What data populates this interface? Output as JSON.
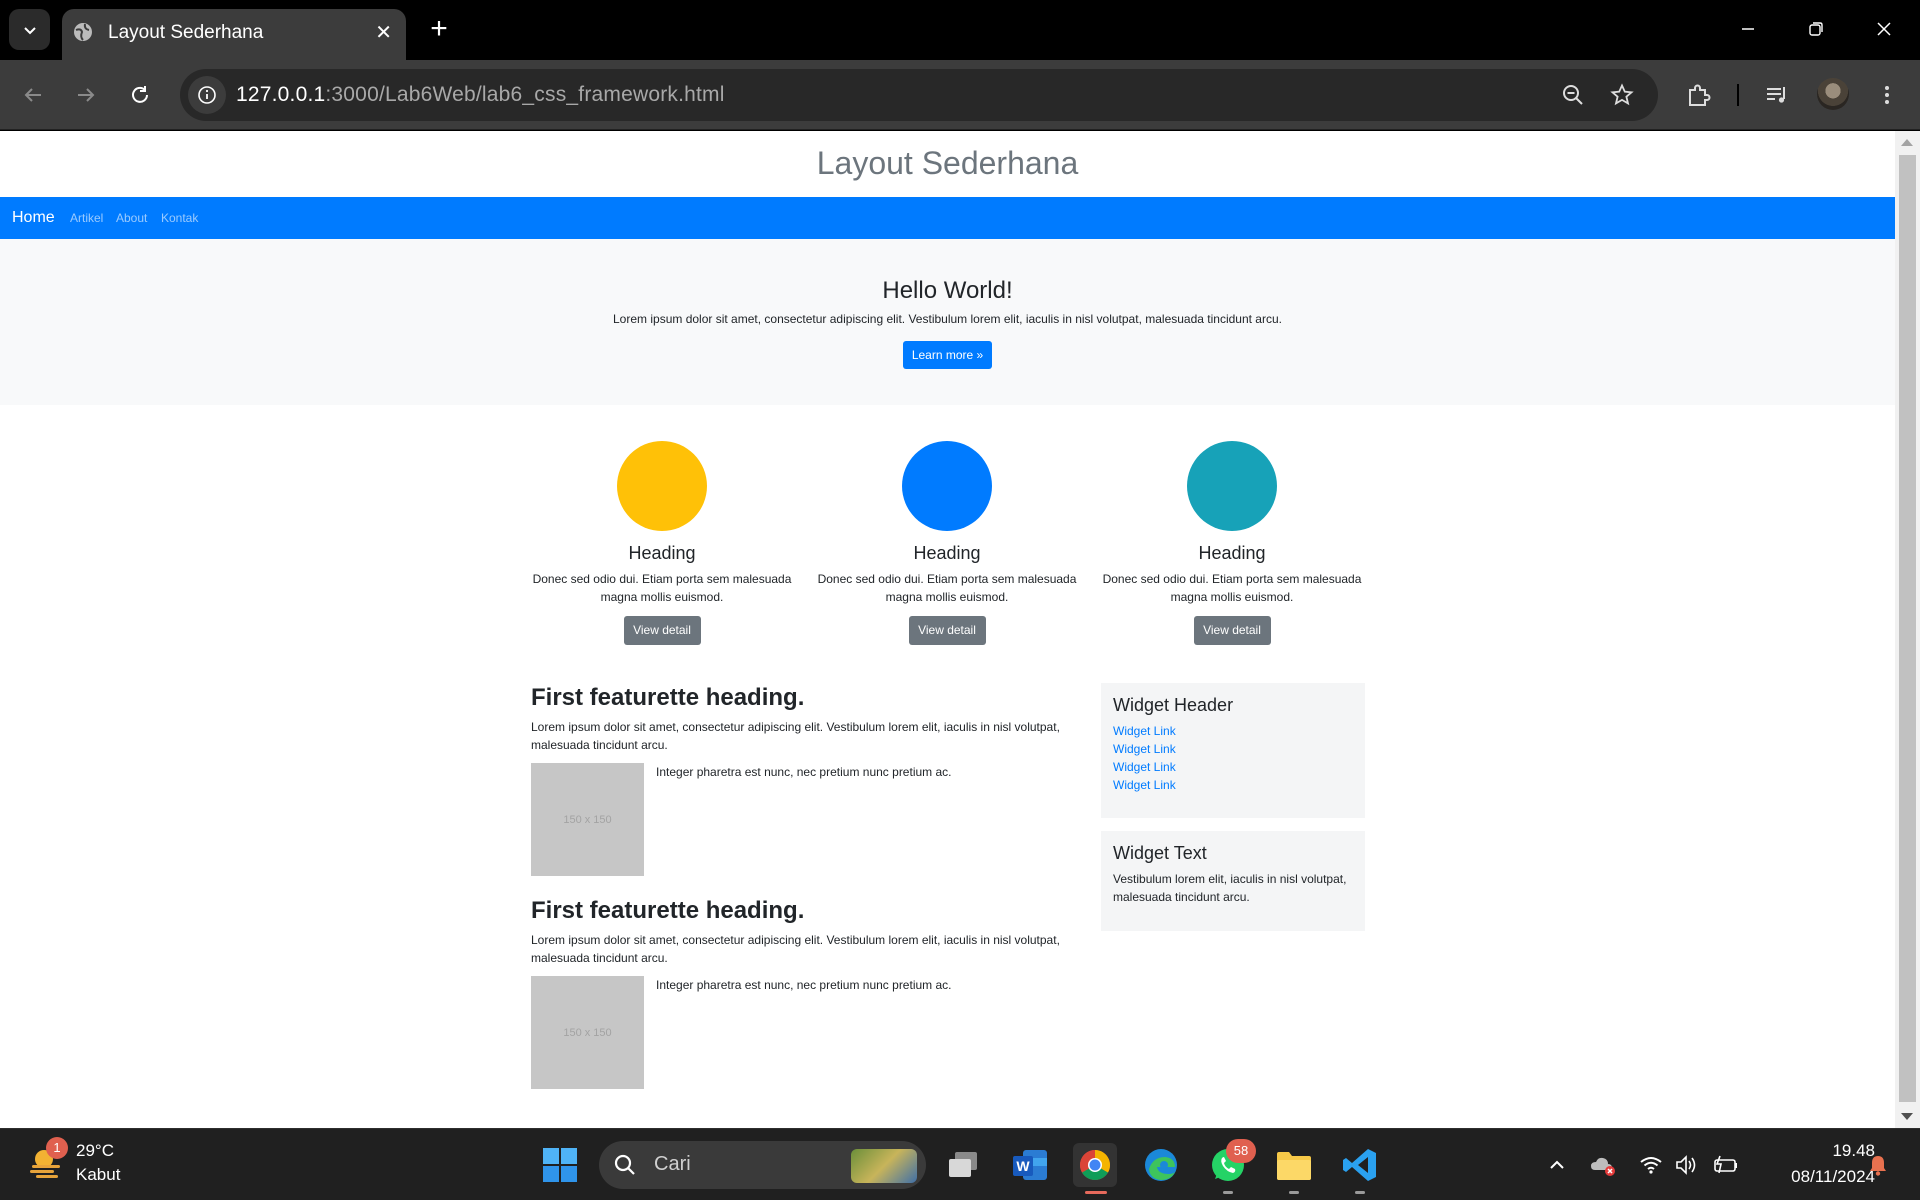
{
  "browser": {
    "tab_title": "Layout Sederhana",
    "url_host": "127.0.0.1",
    "url_rest": ":3000/Lab6Web/lab6_css_framework.html"
  },
  "page": {
    "title": "Layout Sederhana",
    "nav": {
      "home": "Home",
      "artikel": "Artikel",
      "about": "About",
      "kontak": "Kontak"
    },
    "jumbotron": {
      "heading": "Hello World!",
      "text": "Lorem ipsum dolor sit amet, consectetur adipiscing elit. Vestibulum lorem elit, iaculis in nisl volutpat, malesuada tincidunt arcu.",
      "button": "Learn more »"
    },
    "columns": [
      {
        "color": "#ffc107",
        "heading": "Heading",
        "text": "Donec sed odio dui. Etiam porta sem malesuada magna mollis euismod.",
        "button": "View detail"
      },
      {
        "color": "#007bff",
        "heading": "Heading",
        "text": "Donec sed odio dui. Etiam porta sem malesuada magna mollis euismod.",
        "button": "View detail"
      },
      {
        "color": "#17a2b8",
        "heading": "Heading",
        "text": "Donec sed odio dui. Etiam porta sem malesuada magna mollis euismod.",
        "button": "View detail"
      }
    ],
    "featurettes": [
      {
        "heading": "First featurette heading.",
        "lead": "Lorem ipsum dolor sit amet, consectetur adipiscing elit. Vestibulum lorem elit, iaculis in nisl volutpat, malesuada tincidunt arcu.",
        "thumb": "150 x 150",
        "media_text": "Integer pharetra est nunc, nec pretium nunc pretium ac."
      },
      {
        "heading": "First featurette heading.",
        "lead": "Lorem ipsum dolor sit amet, consectetur adipiscing elit. Vestibulum lorem elit, iaculis in nisl volutpat, malesuada tincidunt arcu.",
        "thumb": "150 x 150",
        "media_text": "Integer pharetra est nunc, nec pretium nunc pretium ac."
      }
    ],
    "widget_links": {
      "header": "Widget Header",
      "links": [
        "Widget Link",
        "Widget Link",
        "Widget Link",
        "Widget Link"
      ]
    },
    "widget_text": {
      "header": "Widget Text",
      "text": "Vestibulum lorem elit, iaculis in nisl volutpat, malesuada tincidunt arcu."
    }
  },
  "taskbar": {
    "weather_temp": "29°C",
    "weather_desc": "Kabut",
    "weather_badge": "1",
    "search_placeholder": "Cari",
    "whatsapp_badge": "58",
    "time": "19.48",
    "date": "08/11/2024"
  }
}
